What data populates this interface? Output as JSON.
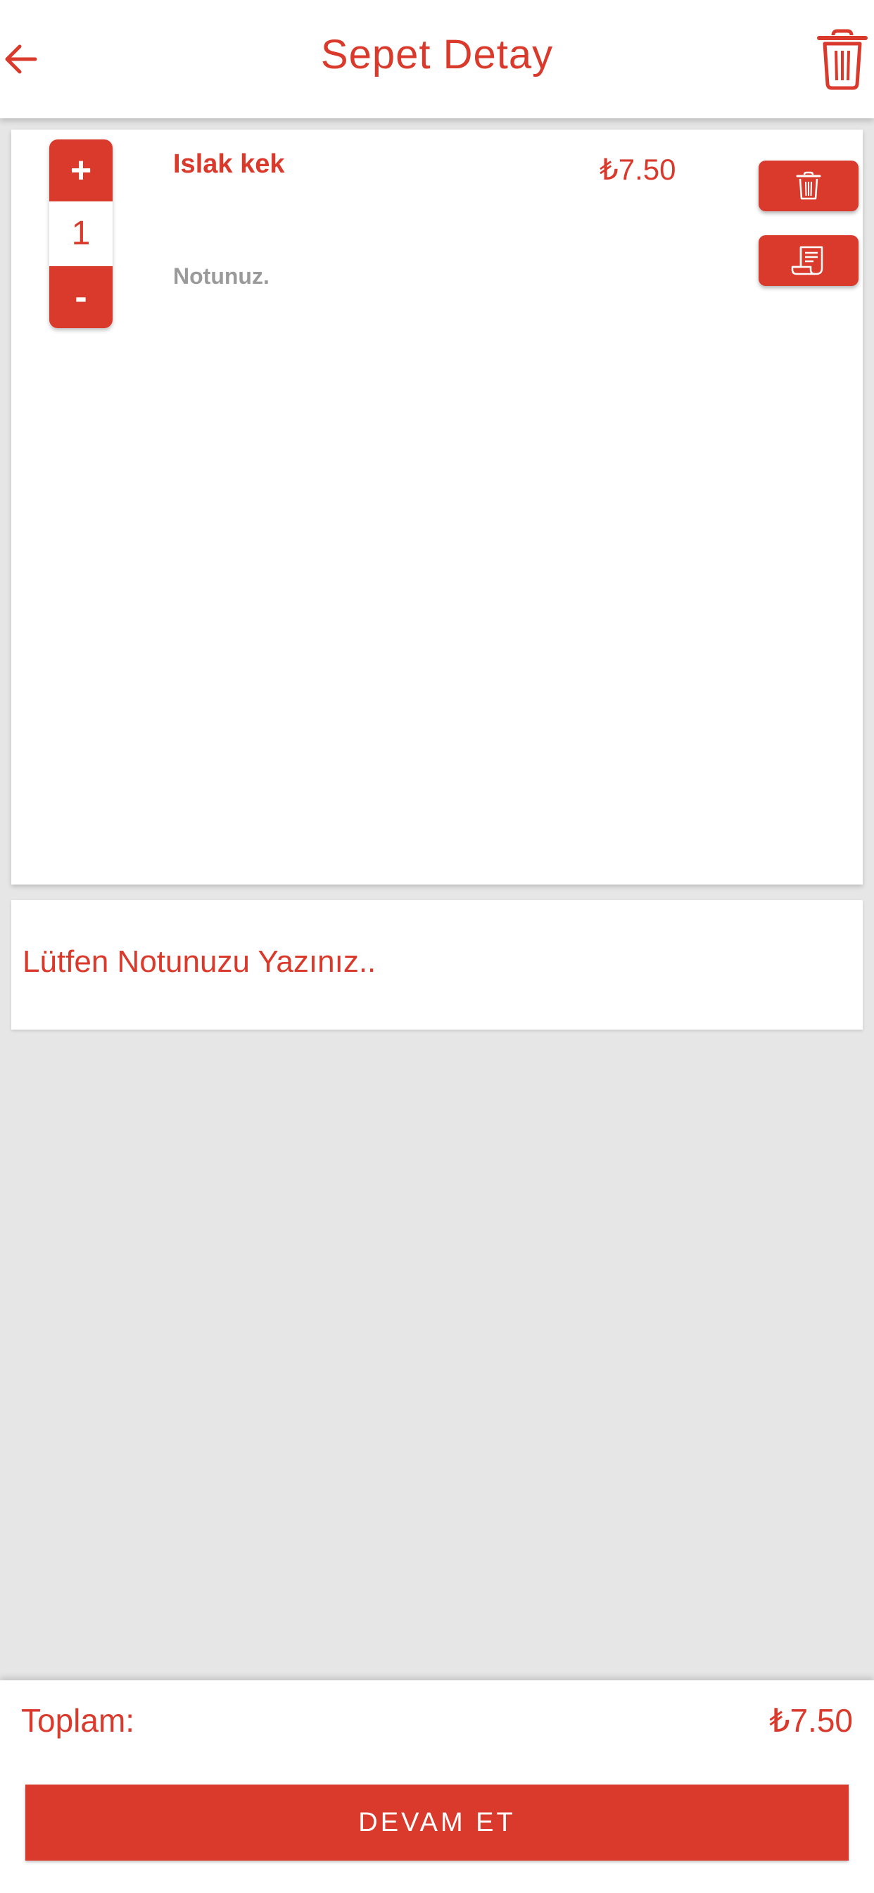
{
  "colors": {
    "accent": "#d93a2c",
    "muted": "#9a9a9a",
    "background": "#e6e6e6",
    "surface": "#ffffff"
  },
  "header": {
    "title": "Sepet Detay",
    "back_icon": "arrow-left-icon",
    "clear_icon": "trash-icon"
  },
  "cart": {
    "items": [
      {
        "name": "Islak kek",
        "price": "₺7.50",
        "quantity": "1",
        "note": "Notunuz.",
        "increment_label": "+",
        "decrement_label": "-",
        "delete_icon": "trash-icon",
        "note_icon": "receipt-note-icon"
      }
    ]
  },
  "order_note": {
    "placeholder": "Lütfen Notunuzu Yazınız..",
    "value": ""
  },
  "footer": {
    "total_label": "Toplam:",
    "total_value": "₺7.50",
    "continue_label": "DEVAM ET"
  }
}
